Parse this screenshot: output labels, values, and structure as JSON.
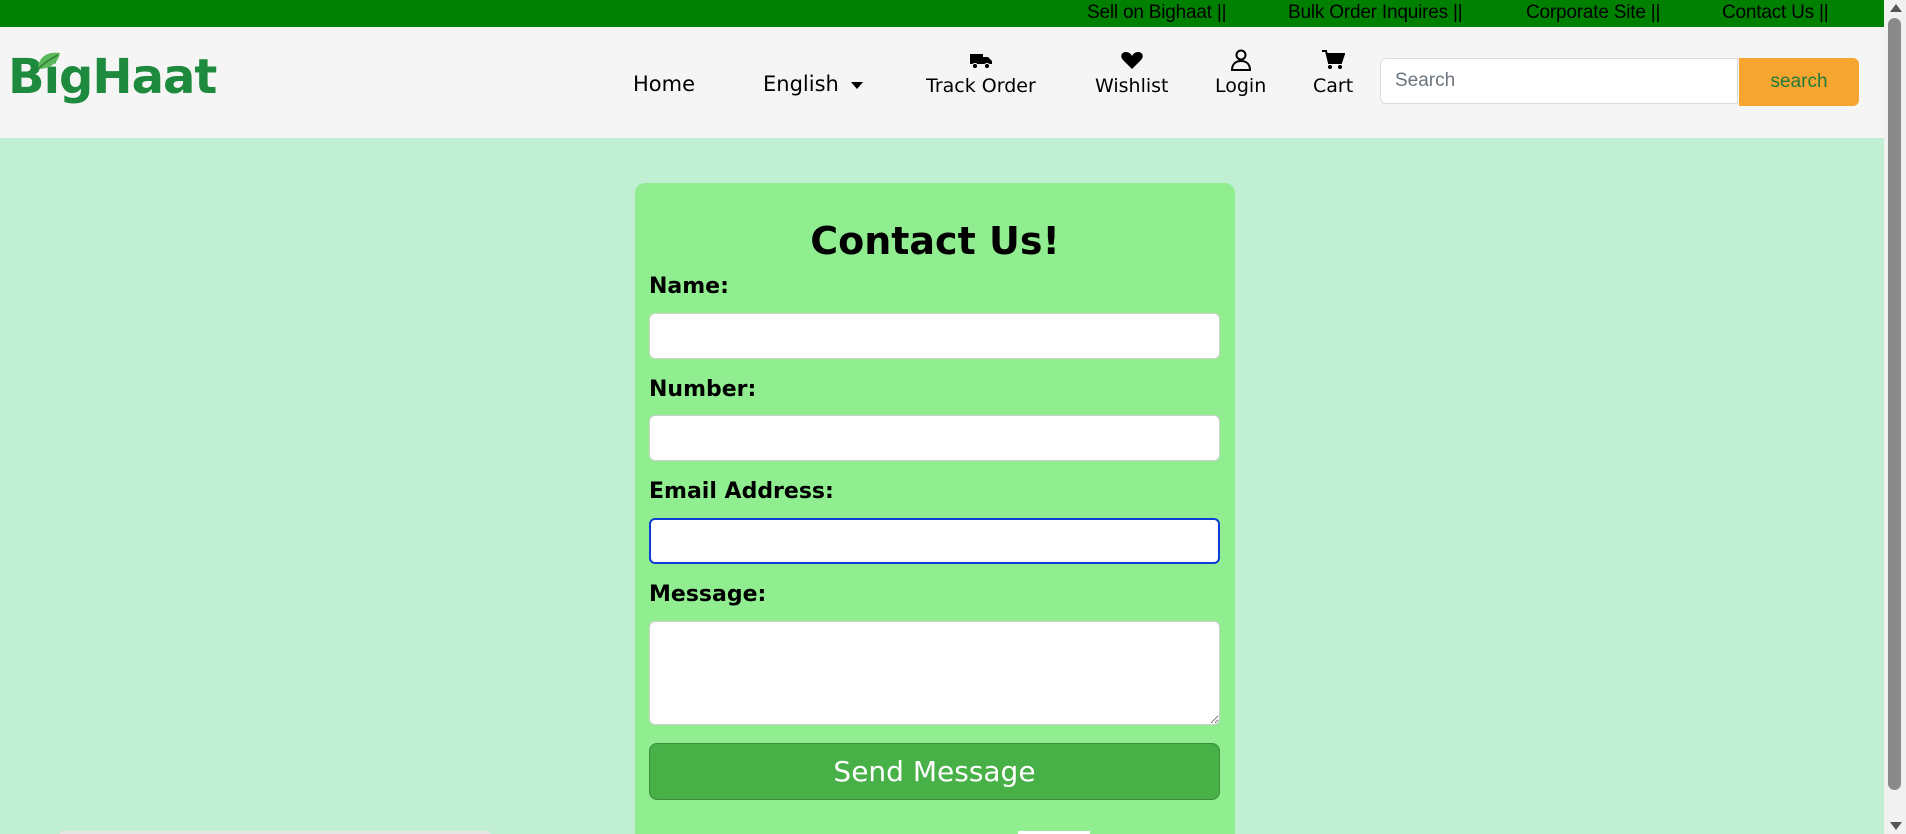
{
  "topbar": {
    "links": [
      "Sell on Bighaat ||",
      "Bulk Order Inquires ||",
      "Corporate Site ||",
      "Contact Us ||"
    ]
  },
  "header": {
    "logo": "BigHaat",
    "nav": {
      "home": "Home",
      "language": "English",
      "track_order": "Track Order",
      "wishlist": "Wishlist",
      "login": "Login",
      "cart": "Cart"
    },
    "search": {
      "placeholder": "Search",
      "button_label": "search"
    }
  },
  "form": {
    "title": "Contact Us!",
    "name_label": "Name:",
    "number_label": "Number:",
    "email_label": "Email Address:",
    "message_label": "Message:",
    "submit_label": "Send Message"
  },
  "colors": {
    "topbar": "#008000",
    "page_bg": "#c0efd3",
    "card_bg": "#90ee90",
    "search_button": "#f7a531",
    "send_button": "#47b047",
    "logo": "#1e8a3e"
  },
  "icons": [
    "leaf-icon",
    "truck-icon",
    "heart-icon",
    "user-icon",
    "cart-icon",
    "chevron-down-icon"
  ]
}
